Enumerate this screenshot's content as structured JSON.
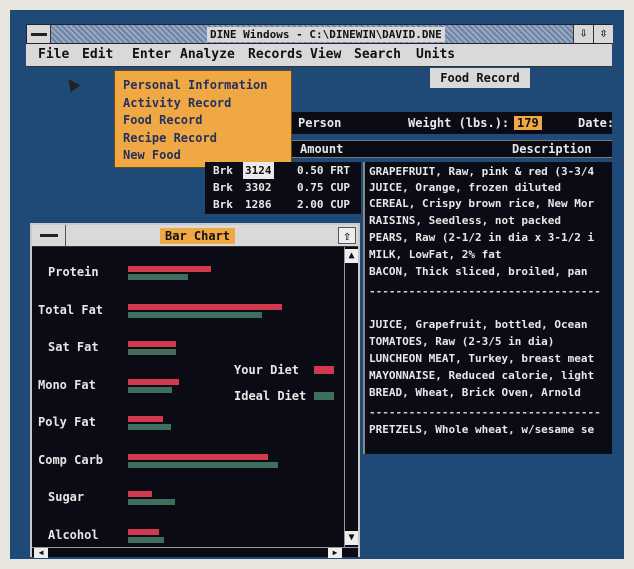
{
  "window": {
    "title": "DINE Windows - C:\\DINEWIN\\DAVID.DNE",
    "minimize_glyph": "⇩",
    "restore_glyph": "⇳"
  },
  "menu": {
    "file": "File",
    "edit": "Edit",
    "enter": "Enter",
    "analyze": "Analyze",
    "records": "Records",
    "view": "View",
    "search": "Search",
    "units": "Units"
  },
  "enter_menu": {
    "items": [
      "Personal Information",
      "Activity Record",
      "Food Record",
      "Recipe Record",
      "New Food"
    ]
  },
  "food_record": {
    "tab_label": "Food Record",
    "person_label": "Person",
    "weight_label": "Weight (lbs.):",
    "weight_value": "179",
    "date_label": "Date:",
    "amount_header": "Amount",
    "description_header": "Description",
    "rows": [
      {
        "meal": "Brk",
        "code": "3124",
        "amount": "0.50 FRT"
      },
      {
        "meal": "Brk",
        "code": "3302",
        "amount": "0.75 CUP"
      },
      {
        "meal": "Brk",
        "code": "1286",
        "amount": "2.00 CUP"
      }
    ],
    "descriptions": [
      "GRAPEFRUIT, Raw, pink & red (3-3/4",
      "JUICE, Orange, frozen diluted",
      "CEREAL, Crispy brown rice, New Mor",
      "RAISINS, Seedless, not packed",
      "PEARS, Raw (2-1/2 in dia x 3-1/2 i",
      "MILK, LowFat, 2% fat",
      "BACON, Thick sliced, broiled, pan",
      "JUICE, Grapefruit, bottled, Ocean",
      "TOMATOES, Raw (2-3/5 in dia)",
      "LUNCHEON MEAT, Turkey, breast meat",
      "MAYONNAISE, Reduced calorie, light",
      "BREAD, Wheat, Brick Oven, Arnold",
      "PRETZELS, Whole wheat, w/sesame se"
    ],
    "separator": "-----------------------------------"
  },
  "bar_chart": {
    "title": "Bar Chart",
    "up_glyph": "⇧",
    "legend": [
      {
        "label": "Your Diet",
        "color": "#d03a4c"
      },
      {
        "label": "Ideal Diet",
        "color": "#3d6f5c"
      }
    ]
  },
  "chart_data": {
    "type": "bar",
    "orientation": "horizontal",
    "categories": [
      "Protein",
      "Total Fat",
      "Sat Fat",
      "Mono Fat",
      "Poly Fat",
      "Comp Carb",
      "Sugar",
      "Alcohol"
    ],
    "series": [
      {
        "name": "Your Diet",
        "values": [
          83,
          154,
          48,
          51,
          35,
          140,
          24,
          31
        ]
      },
      {
        "name": "Ideal Diet",
        "values": [
          60,
          134,
          48,
          44,
          43,
          150,
          47,
          36
        ]
      }
    ]
  },
  "colors": {
    "dropdown": "#f0a844",
    "background": "#1f4a78",
    "panel": "#0b0b15"
  }
}
